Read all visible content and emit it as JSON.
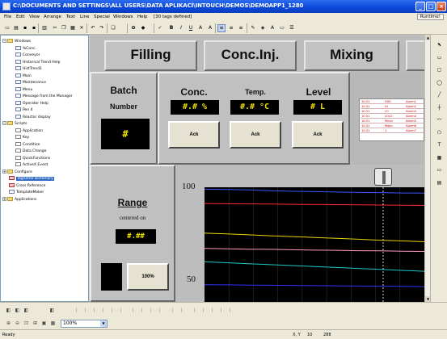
{
  "window": {
    "title": "C:\\DOCUMENTS AND SETTINGS\\ALL USERS\\DATA APLIKACÍ\\INTOUCH\\DEMOS\\DEMOAPP1_1280",
    "minimize": "_",
    "maximize": "□",
    "close": "×"
  },
  "menu": {
    "items": [
      "File",
      "Edit",
      "View",
      "Arrange",
      "Text",
      "Line",
      "Special",
      "Windows",
      "Help"
    ],
    "tags_defined": "[30 tags defined]",
    "runtime_label": "Runtime!"
  },
  "toolbar": {
    "buttons": [
      "new-icon",
      "open-icon",
      "save-icon",
      "save-all-icon",
      "print-icon",
      "cut-icon",
      "copy-icon",
      "paste-icon",
      "delete-icon",
      "undo-icon",
      "redo-icon",
      "duplicate-icon",
      "wizard-icon",
      "tag-icon",
      "spellcheck-icon",
      "bold-icon",
      "italic-icon",
      "underline-icon",
      "font-size-up-icon",
      "font-size-down-icon",
      "align-left-icon",
      "align-center-icon",
      "align-right-icon",
      "line-color-icon",
      "fill-color-icon",
      "text-color-icon",
      "window-color-icon",
      "line-style-icon"
    ],
    "bold": "B",
    "italic": "I",
    "underline": "U",
    "text_a": "A"
  },
  "tree": {
    "items": [
      {
        "label": "Windows",
        "icon": "folder-icon",
        "expander": "−"
      },
      {
        "label": "%Conc.",
        "icon": "window-icon"
      },
      {
        "label": "Conveyor",
        "icon": "window-icon"
      },
      {
        "label": "Historical Trend Help",
        "icon": "window-icon"
      },
      {
        "label": "HistTrend1",
        "icon": "window-icon"
      },
      {
        "label": "Main",
        "icon": "window-icon"
      },
      {
        "label": "Maintenance",
        "icon": "window-icon"
      },
      {
        "label": "Menu",
        "icon": "window-icon"
      },
      {
        "label": "Message from the Manager",
        "icon": "window-icon"
      },
      {
        "label": "Operator Help",
        "icon": "window-icon"
      },
      {
        "label": "Pen 4",
        "icon": "window-icon"
      },
      {
        "label": "Reactor display",
        "icon": "window-icon"
      },
      {
        "label": "Scripts",
        "icon": "folder-icon",
        "expander": "−"
      },
      {
        "label": "Application",
        "icon": "script-icon"
      },
      {
        "label": "Key",
        "icon": "script-icon"
      },
      {
        "label": "Condition",
        "icon": "script-icon"
      },
      {
        "label": "Data Change",
        "icon": "script-icon"
      },
      {
        "label": "QuickFunctions",
        "icon": "script-icon"
      },
      {
        "label": "ActiveX Event",
        "icon": "script-icon"
      },
      {
        "label": "Configure",
        "icon": "folder-icon",
        "expander": "+"
      },
      {
        "label": "Tagname Dictionary",
        "icon": "dictionary-icon"
      },
      {
        "label": "Cross Reference",
        "icon": "cross-reference-icon"
      },
      {
        "label": "TemplateMaker",
        "icon": "template-icon"
      },
      {
        "label": "Applications",
        "icon": "folder-icon",
        "expander": "+"
      }
    ],
    "selected": "Tagname Dictionary"
  },
  "hmi": {
    "tabs": [
      "Filling",
      "Conc.Inj.",
      "Mixing"
    ],
    "batch": {
      "title": "Batch",
      "subtitle": "Number",
      "value": "#"
    },
    "conc": {
      "title": "Conc.",
      "value": "#.# %",
      "ack": "Ack"
    },
    "temp": {
      "title": "Temp.",
      "value": "#.# °C",
      "ack": "Ack"
    },
    "level": {
      "title": "Level",
      "value": "# L",
      "ack": "Ack"
    },
    "alarms": [
      {
        "time": "10:31",
        "type": "HIHI",
        "name": "Alarm1"
      },
      {
        "time": "10:31",
        "type": "HI",
        "name": "Alarm2"
      },
      {
        "time": "10:31",
        "type": "LO",
        "name": "Alarm3"
      },
      {
        "time": "10:31",
        "type": "LOLO",
        "name": "Alarm4"
      },
      {
        "time": "10:31",
        "type": "Minor",
        "name": "Alarm5"
      },
      {
        "time": "10:31",
        "type": "Major",
        "name": "Alarm6"
      },
      {
        "time": "10:31",
        "type": "1",
        "name": "Alarm7"
      }
    ],
    "range": {
      "title": "Range",
      "subtitle": "centered on",
      "value": "#.##",
      "button": "100%"
    },
    "colors": {
      "alarm_text": "#cc0000",
      "lcd_text": "#f0e000"
    }
  },
  "chart_data": {
    "type": "line",
    "title": "",
    "xlabel": "",
    "ylabel": "",
    "ylim": [
      40,
      100
    ],
    "yticks": [
      100,
      50
    ],
    "x": [
      0,
      1,
      2,
      3,
      4,
      5,
      6,
      7,
      8,
      9,
      10
    ],
    "series": [
      {
        "color": "#3a56ff",
        "values": [
          99,
          98.8,
          98.6,
          98.2,
          97.9,
          97.7,
          97.5,
          97.3,
          97.2,
          97.0,
          96.9
        ]
      },
      {
        "color": "#ff2a2a",
        "values": [
          91.5,
          91.4,
          91.3,
          91.2,
          91.1,
          91.0,
          90.9,
          90.8,
          90.7,
          90.6,
          90.5
        ]
      },
      {
        "color": "#e8d400",
        "values": [
          76,
          75.6,
          75.1,
          74.6,
          74.2,
          73.7,
          73.3,
          72.8,
          72.3,
          71.9,
          71.5
        ]
      },
      {
        "color": "#ff9ac8",
        "values": [
          68,
          67.8,
          67.6,
          67.5,
          67.3,
          67.1,
          67.0,
          66.8,
          66.7,
          66.5,
          66.4
        ]
      },
      {
        "color": "#20c8c8",
        "values": [
          61,
          60.5,
          60.0,
          59.5,
          59.0,
          58.5,
          58.0,
          57.5,
          57.0,
          56.5,
          56.0
        ]
      },
      {
        "color": "#3030ff",
        "values": [
          49,
          48.9,
          48.8,
          48.7,
          48.6,
          48.5,
          48.4,
          48.3,
          48.2,
          48.1,
          48.0
        ]
      }
    ]
  },
  "bottom": {
    "zoom_value": "100%"
  },
  "status": {
    "ready": "Ready",
    "xy": "X, Y",
    "x": "10",
    "y": "288"
  }
}
